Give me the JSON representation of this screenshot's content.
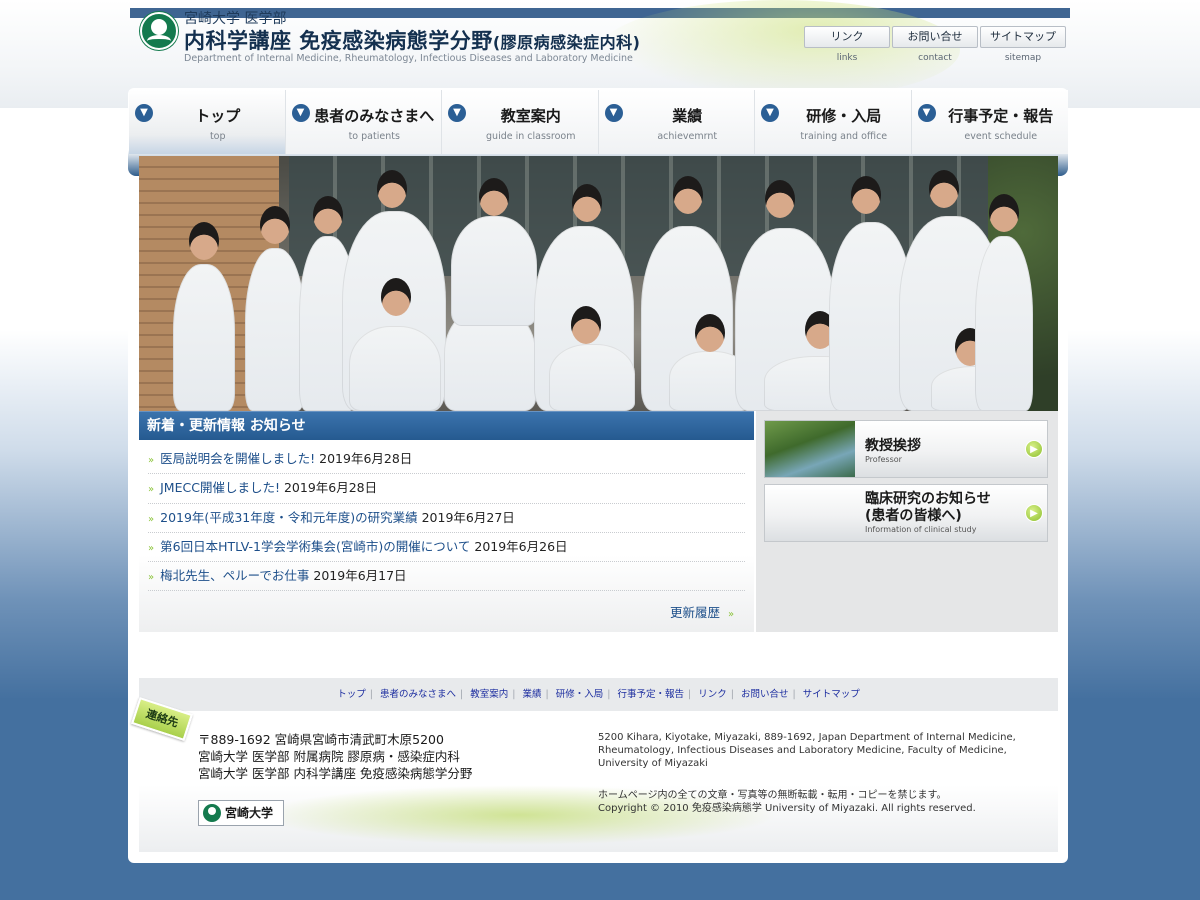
{
  "header": {
    "university": "宮崎大学 医学部",
    "title_main": "内科学講座 免疫感染病態学分野",
    "title_sub": "(膠原病感染症内科)",
    "title_en": "Department of Internal Medicine, Rheumatology, Infectious Diseases and Laboratory Medicine"
  },
  "util_nav": [
    {
      "label": "リンク",
      "sub": "links"
    },
    {
      "label": "お問い合せ",
      "sub": "contact"
    },
    {
      "label": "サイトマップ",
      "sub": "sitemap"
    }
  ],
  "global_nav": [
    {
      "label": "トップ",
      "sub": "top"
    },
    {
      "label": "患者のみなさまへ",
      "sub": "to patients"
    },
    {
      "label": "教室案内",
      "sub": "guide in classroom"
    },
    {
      "label": "業績",
      "sub": "achievemrnt"
    },
    {
      "label": "研修・入局",
      "sub": "training and office"
    },
    {
      "label": "行事予定・報告",
      "sub": "event schedule"
    }
  ],
  "news": {
    "heading": "新着・更新情報 お知らせ",
    "items": [
      {
        "title": "医局説明会を開催しました!",
        "date": "2019年6月28日"
      },
      {
        "title": "JMECC開催しました!",
        "date": "2019年6月28日"
      },
      {
        "title": "2019年(平成31年度・令和元年度)の研究業績",
        "date": "2019年6月27日"
      },
      {
        "title": "第6回日本HTLV-1学会学術集会(宮崎市)の開催について",
        "date": "2019年6月26日"
      },
      {
        "title": "梅北先生、ペルーでお仕事",
        "date": "2019年6月17日"
      }
    ],
    "more": "更新履歴"
  },
  "side": [
    {
      "title": "教授挨拶",
      "title2": "",
      "sub": "Professor"
    },
    {
      "title": "臨床研究のお知らせ",
      "title2": "(患者の皆様へ)",
      "sub": "Information of clinical study"
    }
  ],
  "footer": {
    "nav": [
      "トップ",
      "患者のみなさまへ",
      "教室案内",
      "業績",
      "研修・入局",
      "行事予定・報告",
      "リンク",
      "お問い合せ",
      "サイトマップ"
    ],
    "contact_tag": "連絡先",
    "address_lines": [
      "〒889-1692 宮崎県宮崎市清武町木原5200",
      "宮崎大学 医学部 附属病院 膠原病・感染症内科",
      "宮崎大学 医学部 内科学講座 免疫感染病態学分野"
    ],
    "address_en": "5200 Kihara, Kiyotake, Miyazaki, 889-1692, Japan Department of Internal Medicine, Rheumatology, Infectious Diseases and Laboratory Medicine, Faculty of Medicine, University of Miyazaki",
    "notice": "ホームページ内の全ての文章・写真等の無断転載・転用・コピーを禁じます。",
    "copyright": "Copyright © 2010 免疫感染病態学 University of Miyazaki. All rights reserved.",
    "logo_text": "宮崎大学"
  },
  "colors": {
    "nav_blue": "#2b5f95",
    "news_header": "#255a90",
    "link": "#1d4f8a",
    "accent_green": "#8cc43b",
    "brand_green": "#147a4e"
  }
}
